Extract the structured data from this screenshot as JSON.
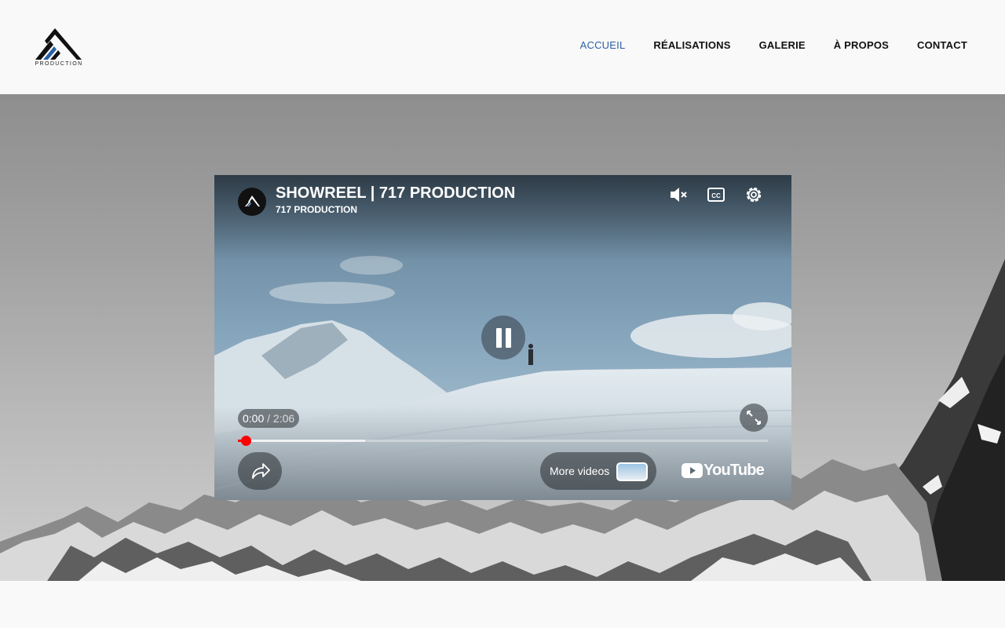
{
  "header": {
    "logo_text": "PRODUCTION",
    "nav": [
      {
        "label": "ACCUEIL",
        "active": true
      },
      {
        "label": "RÉALISATIONS",
        "active": false
      },
      {
        "label": "GALERIE",
        "active": false
      },
      {
        "label": "À PROPOS",
        "active": false
      },
      {
        "label": "CONTACT",
        "active": false
      }
    ],
    "active_color": "#2a5fa8"
  },
  "player": {
    "title": "SHOWREEL | 717 PRODUCTION",
    "channel": "717 PRODUCTION",
    "current_time": "0:00",
    "separator": " / ",
    "duration": "2:06",
    "progress_fraction": 0.0,
    "buffered_fraction": 0.24,
    "more_videos_label": "More videos",
    "youtube_label": "YouTube",
    "progress_color": "#ff0000",
    "icons": [
      "mute-icon",
      "captions-icon",
      "settings-icon",
      "pause-icon",
      "fullscreen-icon",
      "share-icon",
      "youtube-icon"
    ]
  }
}
